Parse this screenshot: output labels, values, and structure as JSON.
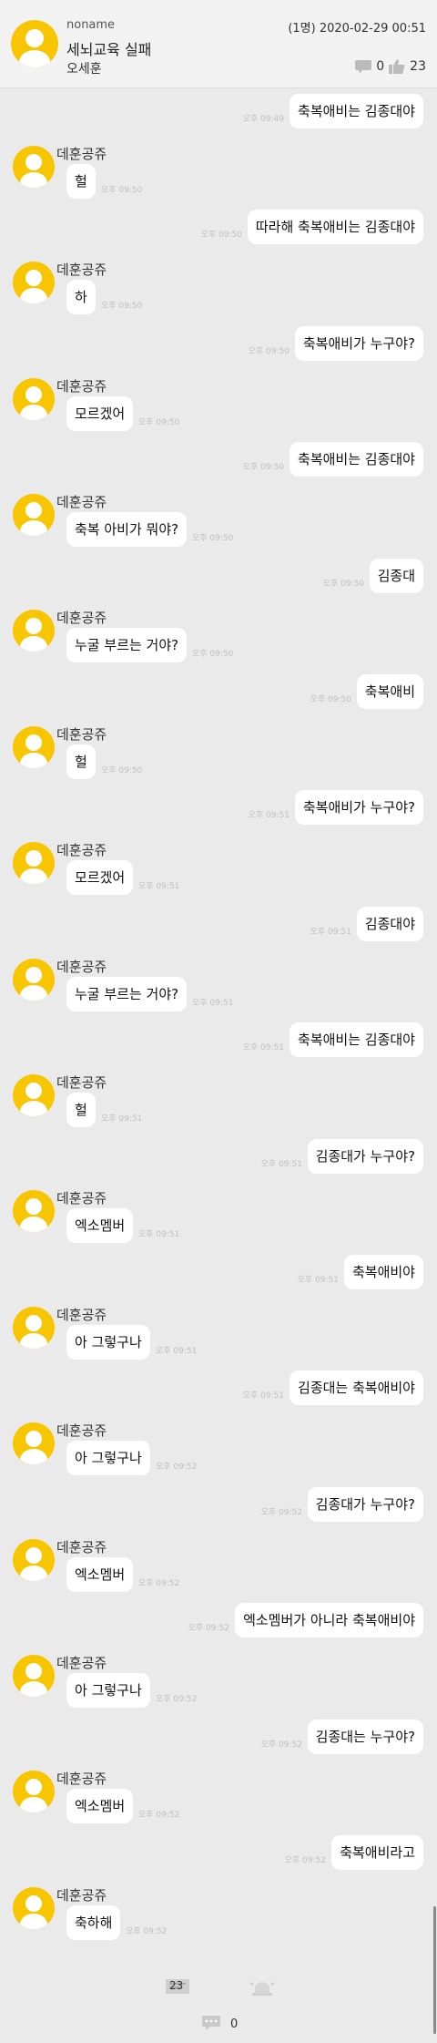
{
  "header": {
    "username": "noname",
    "meta": "(1명) 2020-02-29 00:51",
    "title": "세뇌교육 실패",
    "author": "오세훈",
    "dislike_count": "0",
    "like_count": "23"
  },
  "sender_name": "데훈공쥬",
  "messages": [
    {
      "side": "right",
      "text": "축복애비는 김종대야",
      "time": "오후 09:49"
    },
    {
      "side": "left",
      "text": "헐",
      "time": "오후 09:50"
    },
    {
      "side": "right",
      "text": "따라해 축복애비는 김종대야",
      "time": "오후 09:50"
    },
    {
      "side": "left",
      "text": "하",
      "time": "오후 09:50"
    },
    {
      "side": "right",
      "text": "축복애비가 누구야?",
      "time": "오후 09:50"
    },
    {
      "side": "left",
      "text": "모르겠어",
      "time": "오후 09:50"
    },
    {
      "side": "right",
      "text": "축복애비는 김종대야",
      "time": "오후 09:50"
    },
    {
      "side": "left",
      "text": "축복 아비가 뭐야?",
      "time": "오후 09:50"
    },
    {
      "side": "right",
      "text": "김종대",
      "time": "오후 09:50"
    },
    {
      "side": "left",
      "text": "누굴 부르는 거야?",
      "time": "오후 09:50"
    },
    {
      "side": "right",
      "text": "축복애비",
      "time": "오후 09:50"
    },
    {
      "side": "left",
      "text": "헐",
      "time": "오후 09:50"
    },
    {
      "side": "right",
      "text": "축복애비가 누구야?",
      "time": "오후 09:51"
    },
    {
      "side": "left",
      "text": "모르겠어",
      "time": "오후 09:51"
    },
    {
      "side": "right",
      "text": "김종대야",
      "time": "오후 09:51"
    },
    {
      "side": "left",
      "text": "누굴 부르는 거야?",
      "time": "오후 09:51"
    },
    {
      "side": "right",
      "text": "축복애비는 김종대야",
      "time": "오후 09:51"
    },
    {
      "side": "left",
      "text": "헐",
      "time": "오후 09:51"
    },
    {
      "side": "right",
      "text": "김종대가 누구야?",
      "time": "오후 09:51"
    },
    {
      "side": "left",
      "text": "엑소멤버",
      "time": "오후 09:51"
    },
    {
      "side": "right",
      "text": "축복애비야",
      "time": "오후 09:51"
    },
    {
      "side": "left",
      "text": "아 그렇구나",
      "time": "오후 09:51"
    },
    {
      "side": "right",
      "text": "김종대는 축복애비야",
      "time": "오후 09:51"
    },
    {
      "side": "left",
      "text": "아 그렇구나",
      "time": "오후 09:52"
    },
    {
      "side": "right",
      "text": "김종대가 누구야?",
      "time": "오후 09:52"
    },
    {
      "side": "left",
      "text": "엑소멤버",
      "time": "오후 09:52"
    },
    {
      "side": "right",
      "text": "엑소멤버가 아니라 축복애비야",
      "time": "오후 09:52"
    },
    {
      "side": "left",
      "text": "아 그렇구나",
      "time": "오후 09:52"
    },
    {
      "side": "right",
      "text": "김종대는 누구야?",
      "time": "오후 09:52"
    },
    {
      "side": "left",
      "text": "엑소멤버",
      "time": "오후 09:52"
    },
    {
      "side": "right",
      "text": "축복애비라고",
      "time": "오후 09:52"
    },
    {
      "side": "left",
      "text": "축하해",
      "time": "오후 09:52"
    }
  ],
  "footer": {
    "recommend_count": "23",
    "comment_count": "0"
  },
  "icons": {
    "avatar": "default-profile-icon",
    "dislike": "thumbs-down-icon",
    "like": "thumbs-up-icon",
    "comment": "chat-bubble-icon",
    "alarm": "siren-icon",
    "document": "document-icon"
  },
  "colors": {
    "avatar_bg": "#f7c600",
    "page_bg": "#eaeaea",
    "bubble_bg": "#ffffff"
  }
}
